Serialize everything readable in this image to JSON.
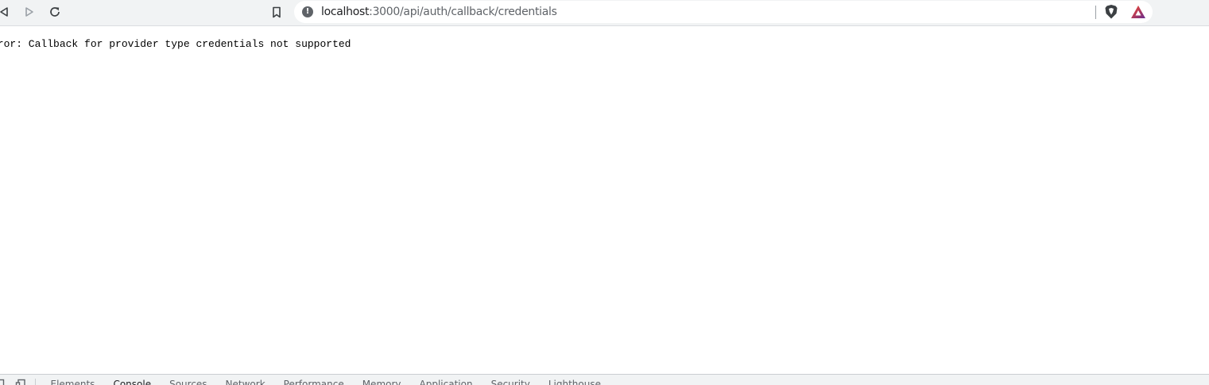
{
  "browser": {
    "url_host": "localhost",
    "url_path": ":3000/api/auth/callback/credentials",
    "icons": {
      "back": "arrow-left-icon",
      "forward": "arrow-right-icon",
      "reload": "reload-icon",
      "bookmark": "bookmark-icon",
      "site_info": "info-icon",
      "shield": "brave-shield-icon",
      "rewards": "brave-rewards-icon"
    },
    "colors": {
      "shield": "#fb542b",
      "rewards_start": "#ff4724",
      "rewards_end": "#662d91"
    }
  },
  "page": {
    "error_message": "rror: Callback for provider type credentials not supported"
  },
  "devtools": {
    "tabs": [
      "Elements",
      "Console",
      "Sources",
      "Network",
      "Performance",
      "Memory",
      "Application",
      "Security",
      "Lighthouse"
    ],
    "active_tab": "Console"
  }
}
